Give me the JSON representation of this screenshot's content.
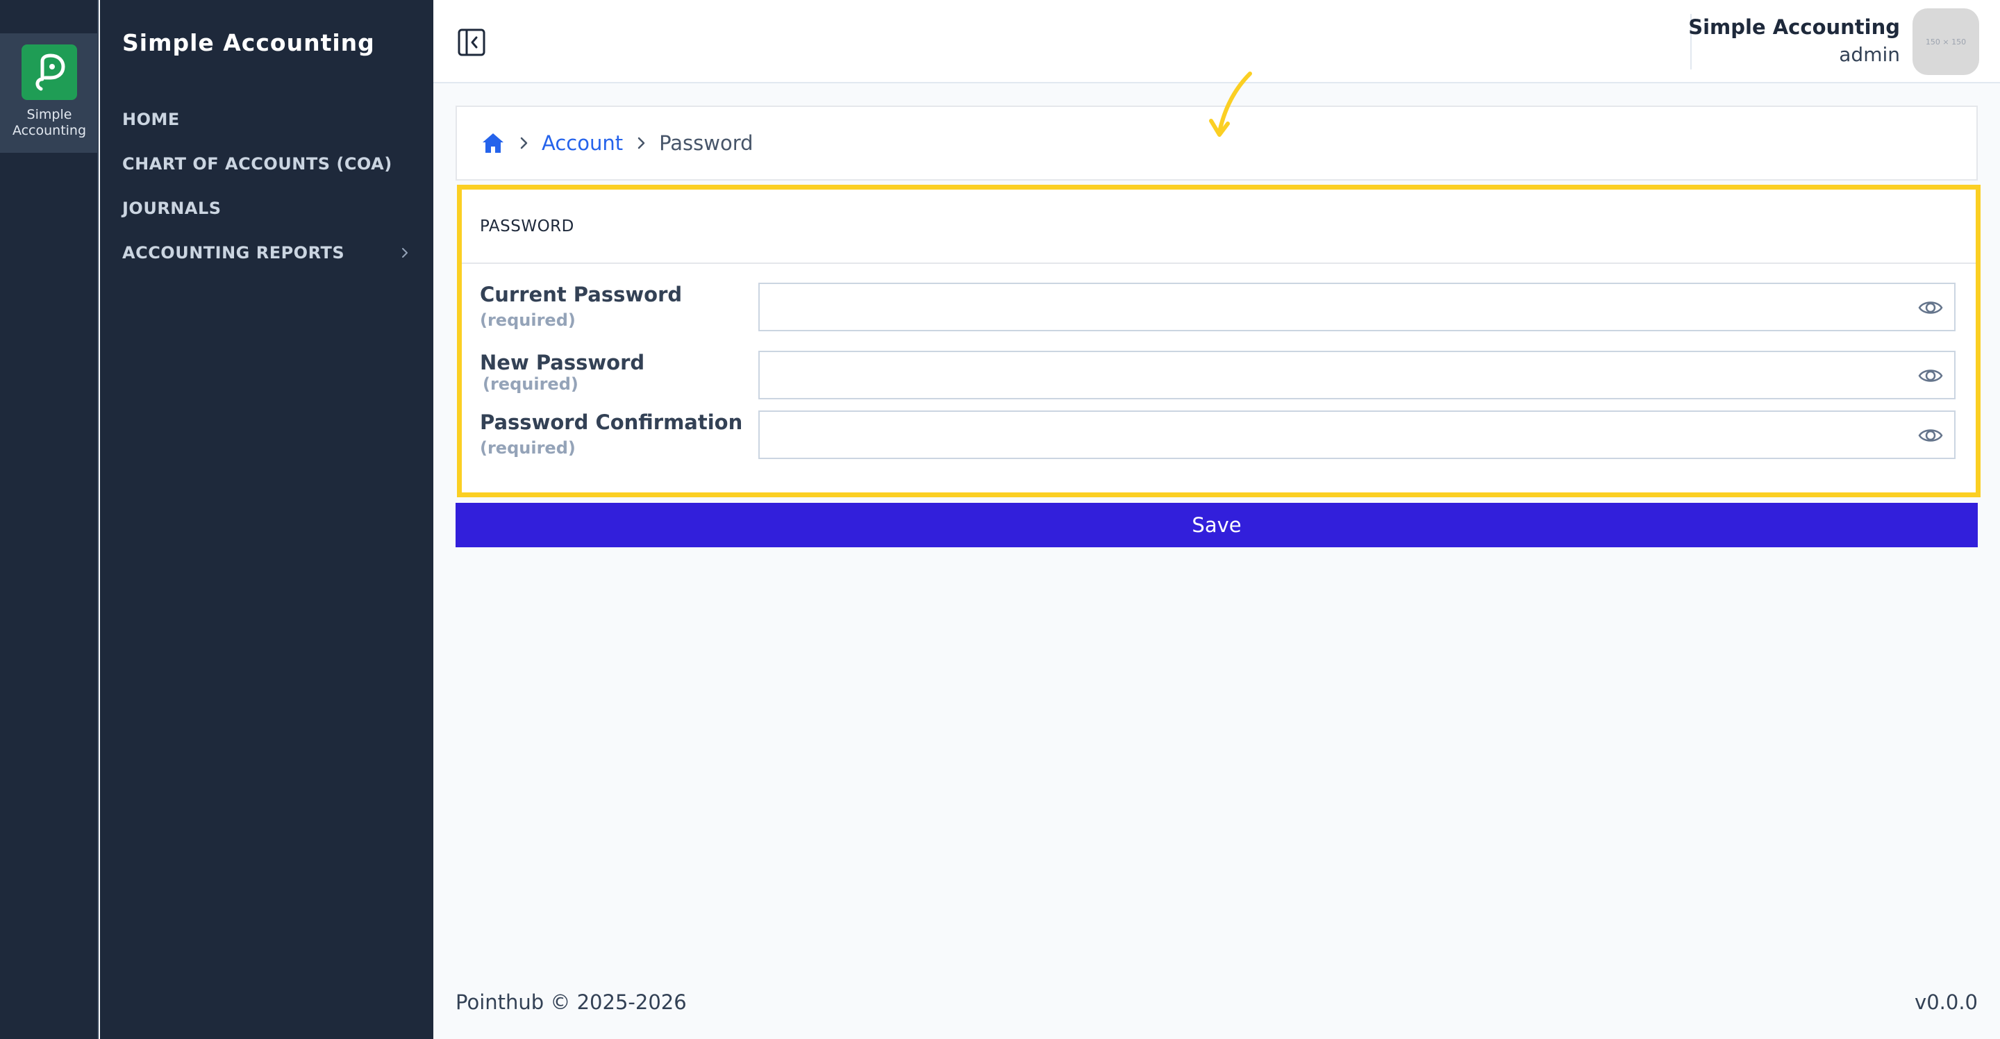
{
  "rail": {
    "app_label_line1": "Simple",
    "app_label_line2": "Accounting",
    "logo_color": "#1f9d55"
  },
  "sidebar": {
    "title": "Simple Accounting",
    "items": [
      {
        "label": "HOME"
      },
      {
        "label": "CHART OF ACCOUNTS (COA)"
      },
      {
        "label": "JOURNALS"
      },
      {
        "label": "ACCOUNTING REPORTS",
        "has_submenu": true
      }
    ]
  },
  "topbar": {
    "user_name": "Simple Accounting",
    "user_role": "admin",
    "avatar_placeholder": "150 × 150"
  },
  "breadcrumb": {
    "items": [
      {
        "icon": "home-icon"
      },
      {
        "label": "Account"
      },
      {
        "label": "Password"
      }
    ]
  },
  "form": {
    "section_title": "PASSWORD",
    "fields": [
      {
        "label": "Current Password",
        "required": "(required)",
        "value": ""
      },
      {
        "label": "New Password",
        "required": "(required)",
        "value": ""
      },
      {
        "label": "Password Confirmation",
        "required": "(required)",
        "value": ""
      }
    ],
    "save_label": "Save",
    "highlight_color": "#fbcf23"
  },
  "footer": {
    "copyright": "Pointhub © 2025-2026",
    "version": "v0.0.0"
  },
  "colors": {
    "sidebar_bg": "#1e293b",
    "primary": "#321fdb",
    "link": "#2563eb"
  }
}
